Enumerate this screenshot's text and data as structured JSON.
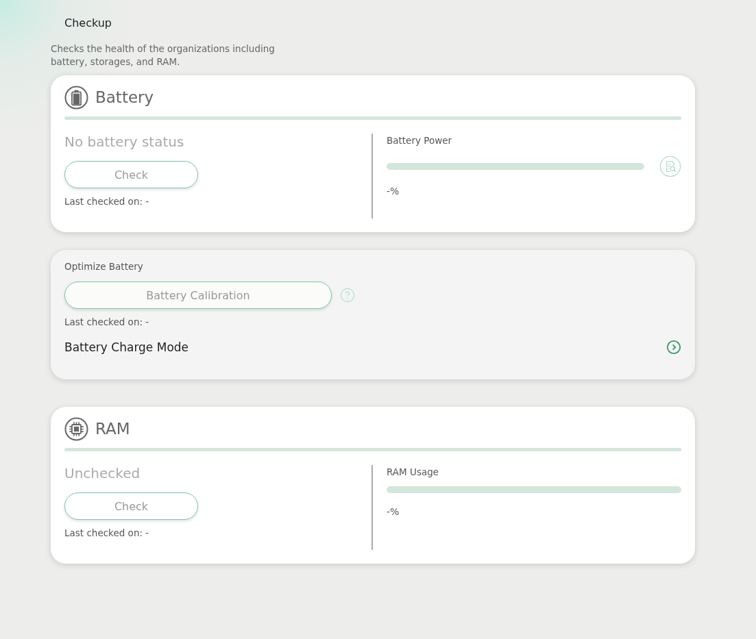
{
  "title": "Checkup",
  "description": "Checks the health of the organizations including battery, storages, and RAM.",
  "sections": [
    {
      "kind": "battery",
      "title": "Battery",
      "status": "No battery status",
      "button": "Check",
      "last_checked": "Last checked on: -",
      "meter": {
        "label": "Battery Power",
        "level": 0,
        "reading": "-%"
      }
    },
    {
      "kind": "optimize",
      "title": "Optimize Battery",
      "button": "Battery Calibration",
      "last_checked": "Last checked on: -",
      "link": "Battery Charge Mode"
    },
    {
      "kind": "ram",
      "title": "RAM",
      "status": "Unchecked",
      "button": "Check",
      "last_checked": "Last checked on: -",
      "meter": {
        "label": "RAM Usage",
        "level": 0,
        "reading": "-%"
      }
    }
  ]
}
